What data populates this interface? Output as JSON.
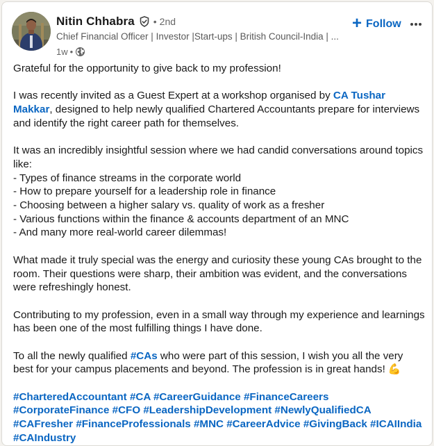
{
  "author": {
    "name": "Nitin Chhabra",
    "separator": "•",
    "degree": "2nd",
    "headline": "Chief Financial Officer | Investor |Start-ups | British Council-India | ...",
    "time": "1w",
    "meta_separator": "•",
    "verified_icon": "verified-shield-icon",
    "visibility_icon": "globe-icon"
  },
  "actions": {
    "follow_label": "Follow",
    "follow_icon": "+",
    "more_icon": "ellipsis-icon"
  },
  "post": {
    "p1": "Grateful for the opportunity to give back to my profession!",
    "p2_before": "I was recently invited as a Guest Expert at a workshop organised by ",
    "p2_mention": "CA Tushar Makkar",
    "p2_after": ", designed to help newly qualified Chartered Accountants prepare for interviews and identify the right career path for themselves.",
    "p3_intro": "It was an incredibly insightful session where we had candid conversations around topics like:",
    "topics": [
      "- Types of finance streams in the corporate world",
      "- How to prepare yourself for a leadership role in finance",
      "- Choosing between a higher salary vs. quality of work as a fresher",
      "- Various functions within the finance & accounts department of an MNC",
      "- And many more real-world career dilemmas!"
    ],
    "p4": "What made it truly special was the energy and curiosity these young CAs brought to the room. Their questions were sharp, their ambition was evident, and the conversations were refreshingly honest.",
    "p5": "Contributing to my profession, even in a small way through my experience and learnings has been one of the most fulfilling things I have done.",
    "p6_before": "To all the newly qualified ",
    "p6_hashtag": "#CAs",
    "p6_after": " who were part of this session, I wish you all the very best for your campus placements and beyond. The profession is in great hands!",
    "p6_emoji": "💪",
    "hashtags": "#CharteredAccountant #CA #CareerGuidance #FinanceCareers #CorporateFinance #CFO #LeadershipDevelopment #NewlyQualifiedCA #CAFresher #FinanceProfessionals #MNC #CareerAdvice #GivingBack #ICAIIndia #CAIndustry"
  },
  "colors": {
    "link": "#0a66c2",
    "text": "#191919",
    "secondary": "#666666",
    "background": "#f4f2ee",
    "card": "#ffffff"
  }
}
